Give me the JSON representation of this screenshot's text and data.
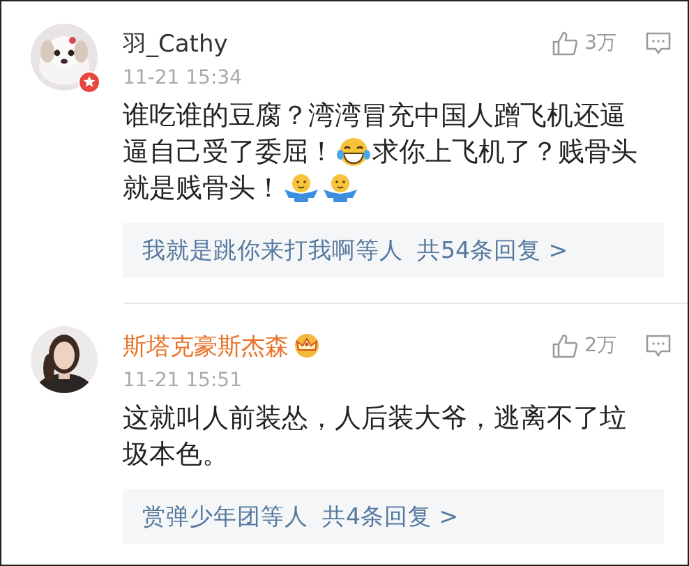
{
  "comments": [
    {
      "user": {
        "name": "羽_Cathy",
        "verified": true,
        "vip": false
      },
      "time": "11-21 15:34",
      "likes": "3万",
      "lines": [
        [
          {
            "kind": "text",
            "text": "谁吃谁的豆腐？湾湾冒充中国人蹭飞机还逼"
          }
        ],
        [
          {
            "kind": "text",
            "text": "逼自己受了委屈！"
          },
          {
            "kind": "laugh"
          },
          {
            "kind": "text",
            "text": "求你上飞机了？贱骨头"
          }
        ],
        [
          {
            "kind": "text",
            "text": "就是贱骨头！"
          },
          {
            "kind": "shrug"
          },
          {
            "kind": "shrug"
          }
        ]
      ],
      "replies": {
        "users": "我就是跳你来打我啊等人",
        "count": "共54条回复 >"
      }
    },
    {
      "user": {
        "name": "斯塔克豪斯杰森",
        "verified": false,
        "vip": true
      },
      "time": "11-21 15:51",
      "likes": "2万",
      "lines": [
        [
          {
            "kind": "text",
            "text": "这就叫人前装怂，人后装大爷，逃离不了垃"
          }
        ],
        [
          {
            "kind": "text",
            "text": "圾本色。"
          }
        ]
      ],
      "replies": {
        "users": "赏弹少年团等人",
        "count": "共4条回复 >"
      }
    }
  ]
}
